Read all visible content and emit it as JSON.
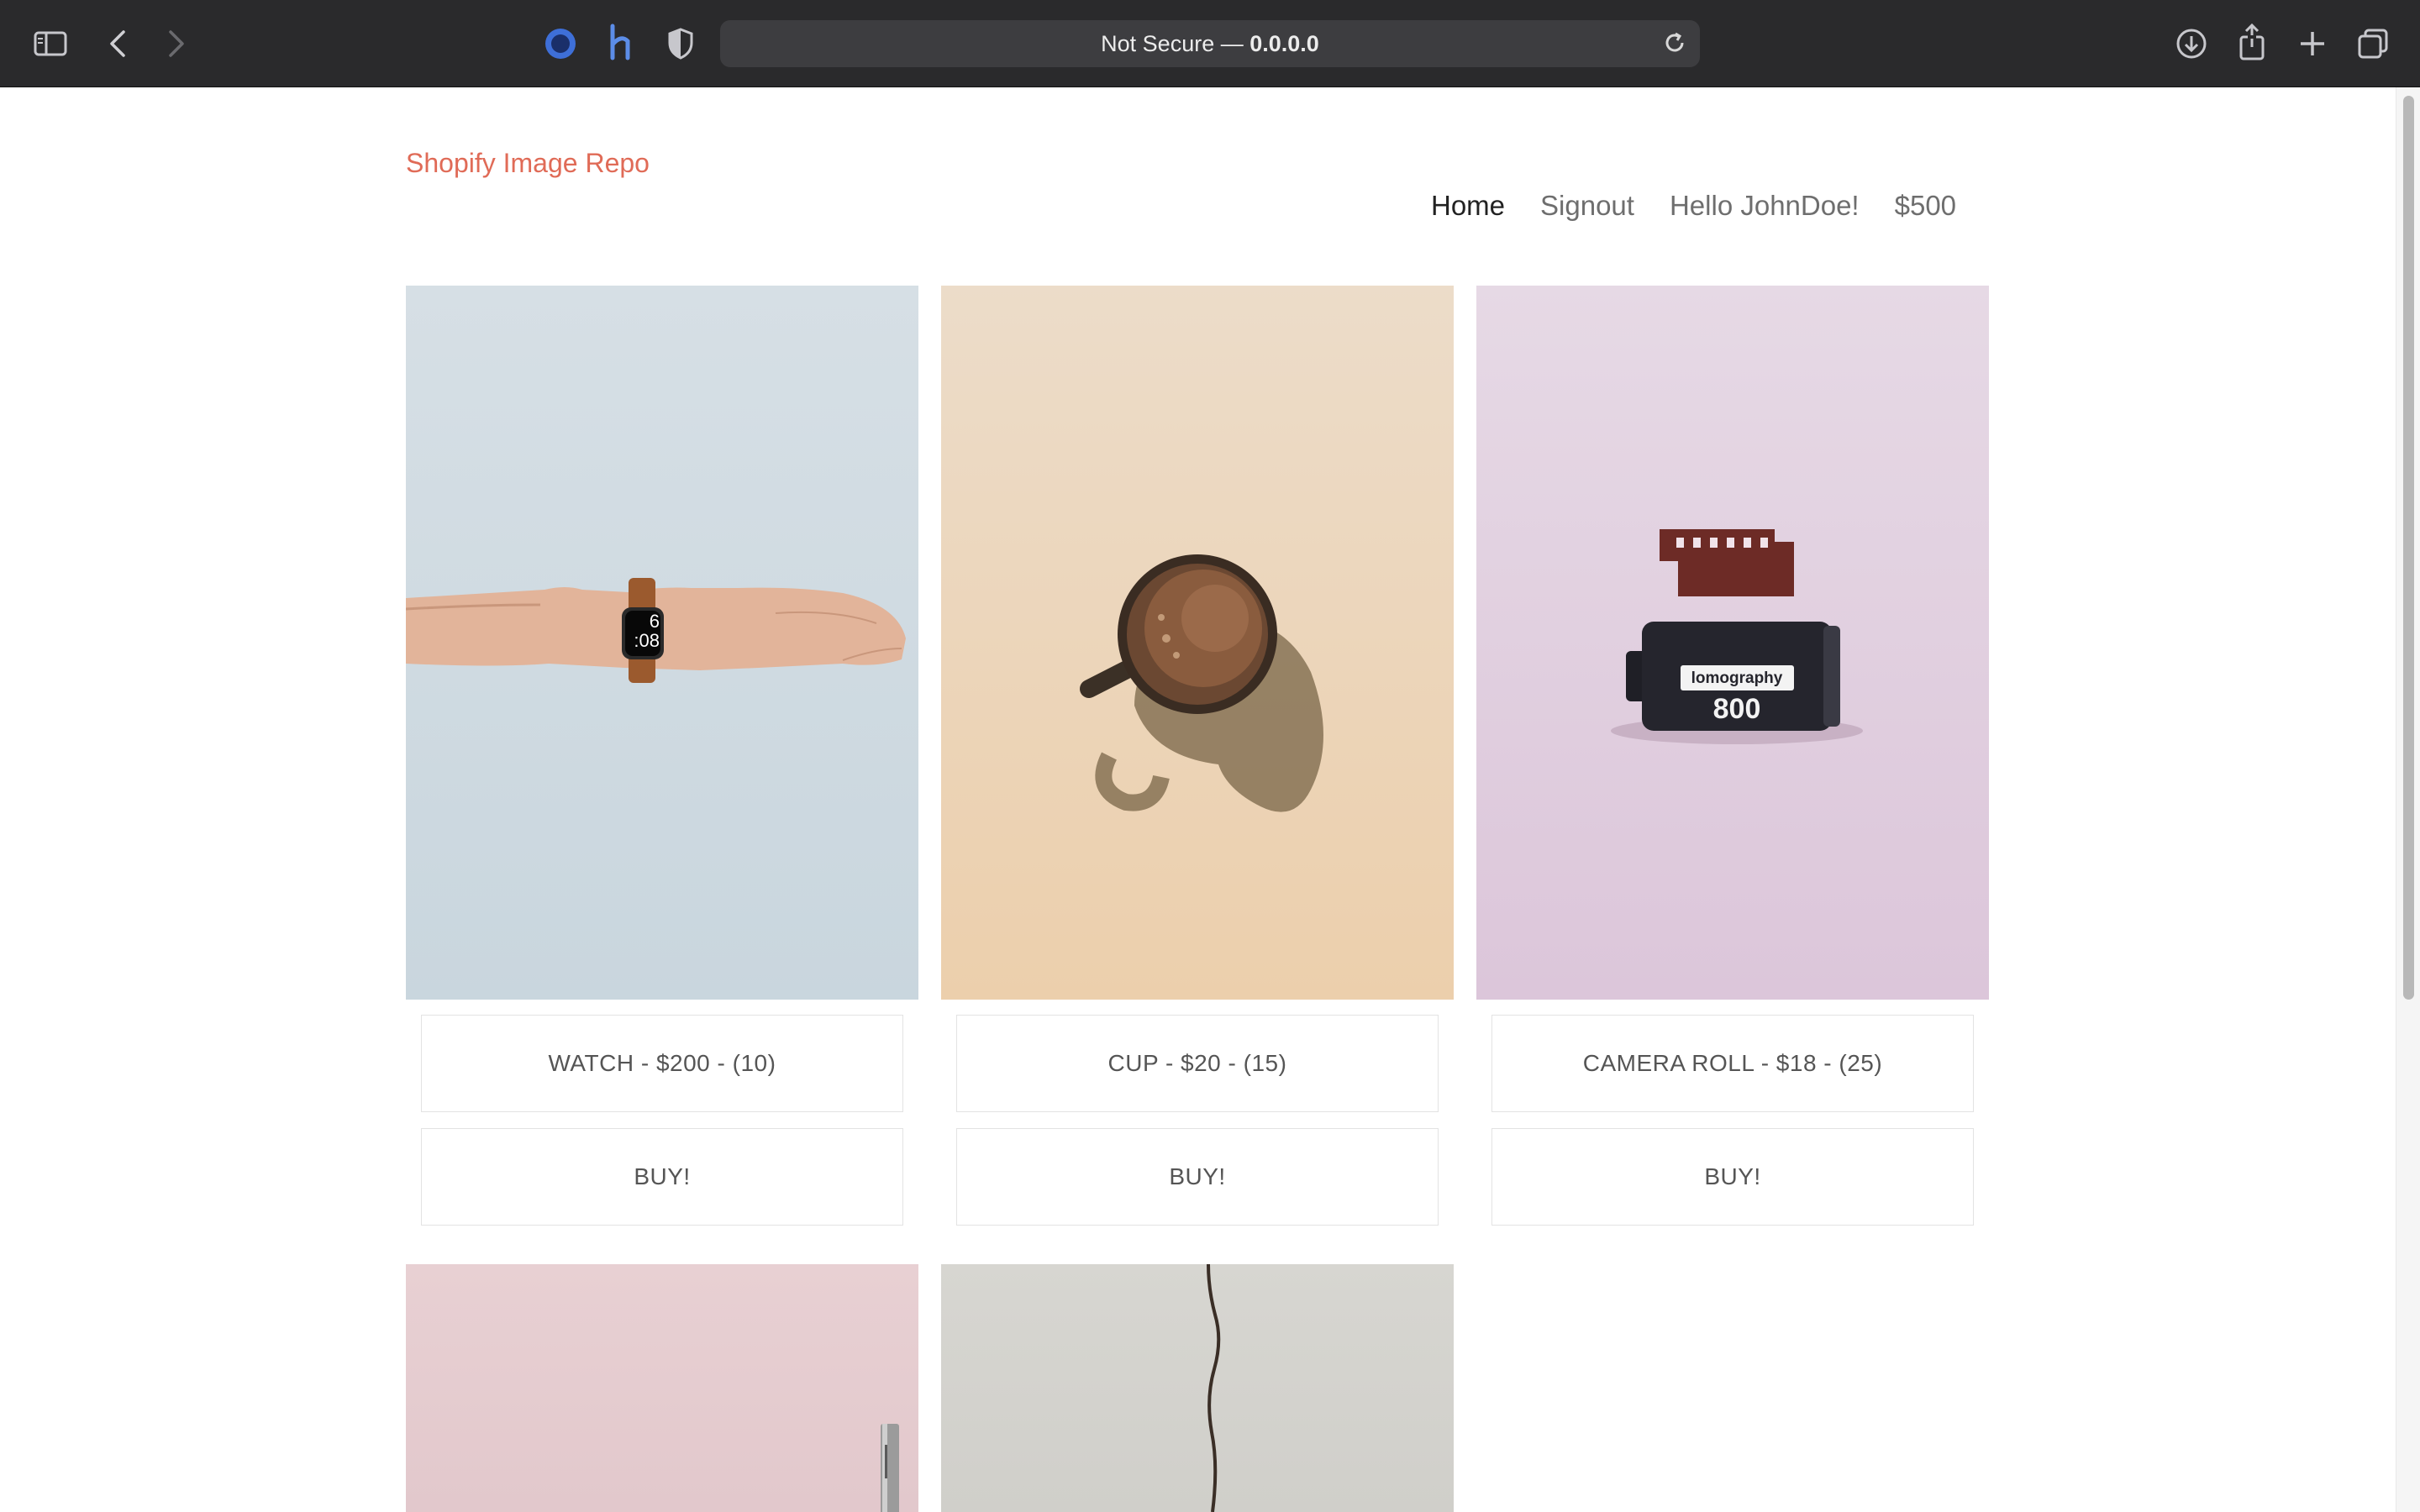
{
  "browser": {
    "address": {
      "prefix": "Not Secure —",
      "host": "0.0.0.0"
    }
  },
  "site": {
    "brand": "Shopify Image Repo",
    "nav": {
      "home": "Home",
      "signout": "Signout",
      "greeting": "Hello JohnDoe!",
      "balance": "$500"
    }
  },
  "products": [
    {
      "label": "WATCH - $200 - (10)",
      "buy": "BUY!"
    },
    {
      "label": "CUP - $20 - (15)",
      "buy": "BUY!"
    },
    {
      "label": "CAMERA ROLL - $18 - (25)",
      "buy": "BUY!"
    }
  ],
  "images": {
    "watch_face": {
      "line1": "6",
      "line2": ":08"
    },
    "film_brand": "lomography",
    "film_iso": "800"
  }
}
